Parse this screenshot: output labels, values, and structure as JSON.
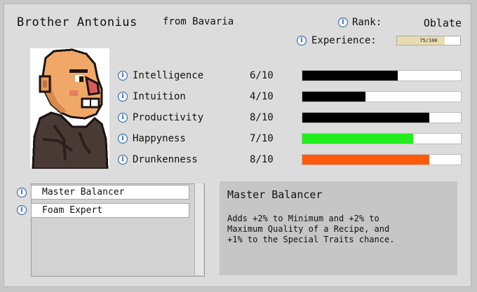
{
  "header": {
    "name": "Brother Antonius",
    "origin": "from Bavaria"
  },
  "rank": {
    "label": "Rank:",
    "value": "Oblate"
  },
  "experience": {
    "label": "Experience:",
    "text": "75/100",
    "current": 75,
    "max": 100
  },
  "portrait": {
    "icon": "monk-portrait",
    "description_visible": false
  },
  "stats": [
    {
      "label": "Intelligence",
      "value_text": "6/10",
      "value": 6,
      "max": 10,
      "color": "#000000"
    },
    {
      "label": "Intuition",
      "value_text": "4/10",
      "value": 4,
      "max": 10,
      "color": "#000000"
    },
    {
      "label": "Productivity",
      "value_text": "8/10",
      "value": 8,
      "max": 10,
      "color": "#000000"
    },
    {
      "label": "Happyness",
      "value_text": "7/10",
      "value": 7,
      "max": 10,
      "color": "#22ee1e"
    },
    {
      "label": "Drunkenness",
      "value_text": "8/10",
      "value": 8,
      "max": 10,
      "color": "#ff5a0a"
    }
  ],
  "traits": [
    {
      "label": "Master Balancer"
    },
    {
      "label": "Foam Expert"
    }
  ],
  "detail": {
    "title": "Master Balancer",
    "body": "Adds +2% to Minimum and +2% to\nMaximum Quality of a Recipe, and\n+1% to the Special Traits chance."
  },
  "icons": {
    "info": "i"
  }
}
